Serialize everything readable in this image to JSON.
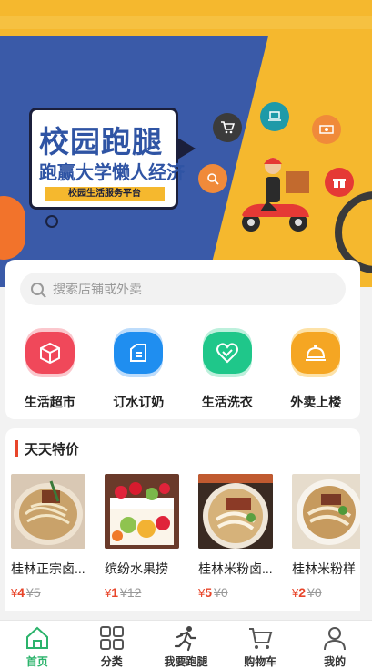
{
  "banner": {
    "title": "校园跑腿",
    "subtitle": "跑赢大学懒人经济",
    "tag": "校园生活服务平台"
  },
  "search": {
    "placeholder": "搜索店铺或外卖"
  },
  "categories": [
    {
      "label": "生活超市",
      "icon": "box-icon",
      "color": "#f0485a"
    },
    {
      "label": "订水订奶",
      "icon": "milk-icon",
      "color": "#1f8ef0"
    },
    {
      "label": "生活洗衣",
      "icon": "heart-shield-icon",
      "color": "#1fc78a"
    },
    {
      "label": "外卖上楼",
      "icon": "cloche-icon",
      "color": "#f5a623"
    }
  ],
  "deals": {
    "title": "天天特价",
    "products": [
      {
        "name": "桂林正宗卤...",
        "price_symbol": "¥",
        "price": "4",
        "original": "¥5"
      },
      {
        "name": "缤纷水果捞",
        "price_symbol": "¥",
        "price": "1",
        "original": "¥12"
      },
      {
        "name": "桂林米粉卤...",
        "price_symbol": "¥",
        "price": "5",
        "original": "¥0"
      },
      {
        "name": "桂林米粉样",
        "price_symbol": "¥",
        "price": "2",
        "original": "¥0"
      }
    ]
  },
  "tabbar": [
    {
      "label": "首页",
      "icon": "home-icon",
      "active": true
    },
    {
      "label": "分类",
      "icon": "grid-icon",
      "active": false
    },
    {
      "label": "我要跑腿",
      "icon": "runner-icon",
      "active": false
    },
    {
      "label": "购物车",
      "icon": "cart-icon",
      "active": false
    },
    {
      "label": "我的",
      "icon": "user-icon",
      "active": false
    }
  ],
  "colors": {
    "accent": "#2bb36b",
    "price": "#e8452a",
    "banner_bg": "#f5b82e",
    "banner_blue": "#3a5aa8"
  }
}
